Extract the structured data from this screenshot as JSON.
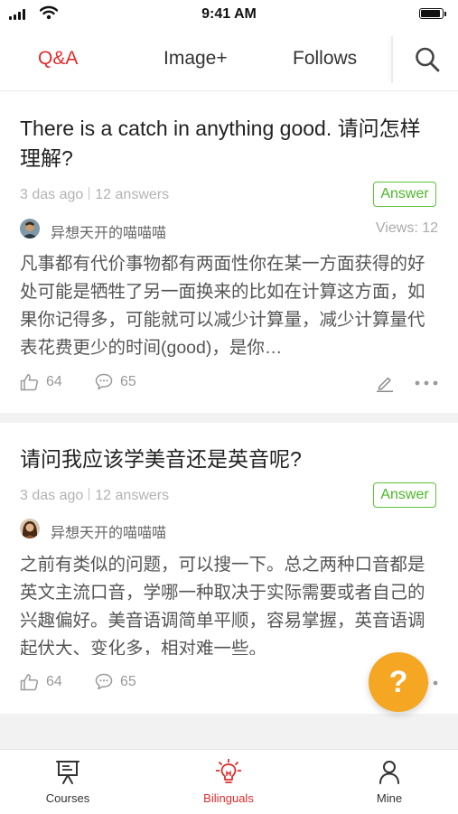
{
  "status_bar": {
    "time": "9:41 AM"
  },
  "tabs": [
    {
      "label": "Q&A",
      "active": true
    },
    {
      "label": "Image+",
      "active": false
    },
    {
      "label": "Follows",
      "active": false
    }
  ],
  "icons": {
    "search": "search-icon",
    "like": "thumbs-up-icon",
    "comment": "comment-icon",
    "edit": "pencil-icon",
    "more": "more-dots-icon"
  },
  "colors": {
    "accent": "#e02b2b",
    "answer_green": "#4cb82a",
    "fab": "#f5a623"
  },
  "questions": [
    {
      "title": "There is a catch in anything good. 请问怎样理解?",
      "age": "3 das ago",
      "answers": "12 answers",
      "badge": "Answer",
      "user": "异想天开的喵喵喵",
      "views": "Views: 12",
      "body": "凡事都有代价事物都有两面性你在某一方面获得的好处可能是牺牲了另一面换来的比如在计算这方面，如果你记得多，可能就可以减少计算量，减少计算量代表花费更少的时间(good)，是你…",
      "likes": "64",
      "comments": "65"
    },
    {
      "title": "请问我应该学美音还是英音呢?",
      "age": "3 das ago",
      "answers": "12 answers",
      "badge": "Answer",
      "user": "异想天开的喵喵喵",
      "body": "之前有类似的问题，可以搜一下。总之两种口音都是英文主流口音，学哪一种取决于实际需要或者自己的兴趣偏好。美音语调简单平顺，容易掌握，英音语调起伏大、变化多，相对难一些。",
      "likes": "64",
      "comments": "65"
    }
  ],
  "fab": {
    "label": "?"
  },
  "bottom_nav": [
    {
      "label": "Courses",
      "icon": "presentation-board-icon",
      "active": false
    },
    {
      "label": "Bilinguals",
      "icon": "lightbulb-icon",
      "active": true
    },
    {
      "label": "Mine",
      "icon": "person-icon",
      "active": false
    }
  ]
}
